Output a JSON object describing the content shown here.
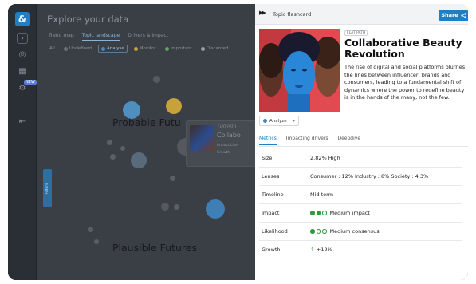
{
  "app": {
    "logo": "&",
    "title": "Explore your data",
    "tabs": [
      "Trend map",
      "Topic landscape",
      "Drivers & impact"
    ],
    "filters": [
      {
        "label": "All",
        "color": ""
      },
      {
        "label": "Undefined",
        "color": "#6b7178"
      },
      {
        "label": "Analyse",
        "color": "#4a87c1"
      },
      {
        "label": "Monitor",
        "color": "#c9a53a"
      },
      {
        "label": "Important",
        "color": "#5aa85f"
      },
      {
        "label": "Discarded",
        "color": "#9aa0a6"
      }
    ],
    "new_badge": "NEW",
    "future_labels": [
      "Probable Futu",
      "Plausible Futures"
    ],
    "side_tab": "Filters",
    "mini_card": {
      "tag": "FLAT PATH",
      "title": "Collabo",
      "row1": "Impact  Like",
      "row2": "Growth"
    }
  },
  "panel": {
    "title": "Topic flashcard",
    "share_label": "Share",
    "tag": "FLAT PATH",
    "card_title": "Collaborative Beauty Revolution",
    "description": "The rise of digital and social platforms blurries the lines between influencer, brands and consumers, leading to a fundamental shift of dynamics where the power to redefine beauty is in the hands of the many, not the few.",
    "status": "Analyze",
    "tabs": [
      "Metrics",
      "Impacting drivers",
      "Deepdive"
    ],
    "metrics": [
      {
        "label": "Size",
        "value": "2.82%  High"
      },
      {
        "label": "Lenses",
        "value": "Consumer : 12%   Industry : 8%   Society : 4.3%"
      },
      {
        "label": "Timeline",
        "value": "Mid term"
      },
      {
        "label": "Impact",
        "value": "Medium impact",
        "filled": 2
      },
      {
        "label": "Likelihood",
        "value": "Medium consensus",
        "filled": 1
      },
      {
        "label": "Growth",
        "value": "+12%"
      }
    ]
  },
  "colors": {
    "accent": "#1d80c4",
    "good": "#2f9a3e"
  }
}
